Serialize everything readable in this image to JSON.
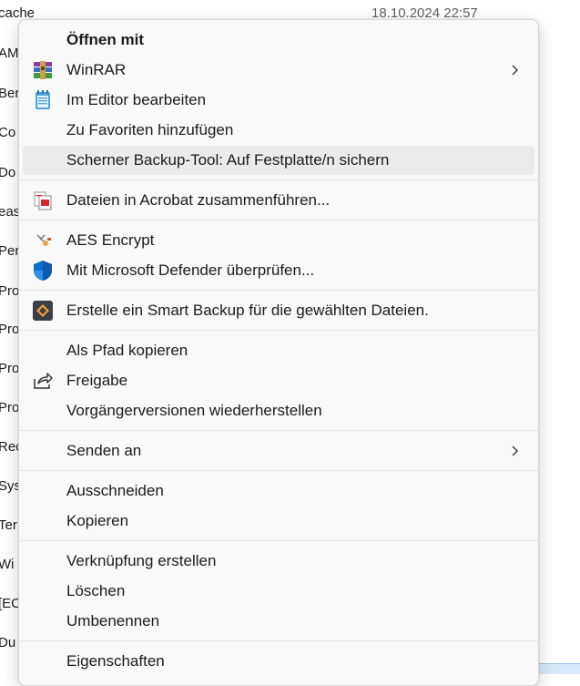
{
  "background": {
    "date_text": "18.10.2024 22:57",
    "rows": [
      "cache",
      "AM",
      "Ber",
      "Co",
      "Do",
      "eas",
      "Per",
      "Pro",
      "Pro",
      "Pro",
      "Pro",
      "Rec",
      "Sys",
      "Ter",
      "Wi",
      "[EC",
      "Du"
    ]
  },
  "menu": {
    "open_with": "Öffnen mit",
    "winrar": "WinRAR",
    "editor": "Im Editor bearbeiten",
    "favorites": "Zu Favoriten hinzufügen",
    "backup_tool": "Scherner Backup-Tool: Auf Festplatte/n sichern",
    "acrobat": "Dateien in Acrobat zusammenführen...",
    "aes": "AES Encrypt",
    "defender": "Mit Microsoft Defender überprüfen...",
    "smart_backup": "Erstelle ein Smart Backup für die gewählten Dateien.",
    "copy_path": "Als Pfad kopieren",
    "share": "Freigabe",
    "previous_versions": "Vorgängerversionen wiederherstellen",
    "send_to": "Senden an",
    "cut": "Ausschneiden",
    "copy": "Kopieren",
    "shortcut": "Verknüpfung erstellen",
    "delete": "Löschen",
    "rename": "Umbenennen",
    "properties": "Eigenschaften"
  },
  "colors": {
    "menu_bg": "#f9f9f9",
    "hover_bg": "#ebebeb",
    "defender_blue": "#0a6ed1",
    "winrar_purple": "#7b2a8c"
  },
  "icons": {
    "winrar": "winrar-icon",
    "editor": "notepad-icon",
    "acrobat": "acrobat-icon",
    "aes": "aes-icon",
    "defender": "shield-icon",
    "smart_backup": "backup-diamond-icon",
    "share": "share-icon",
    "submenu": "chevron-right-icon"
  }
}
